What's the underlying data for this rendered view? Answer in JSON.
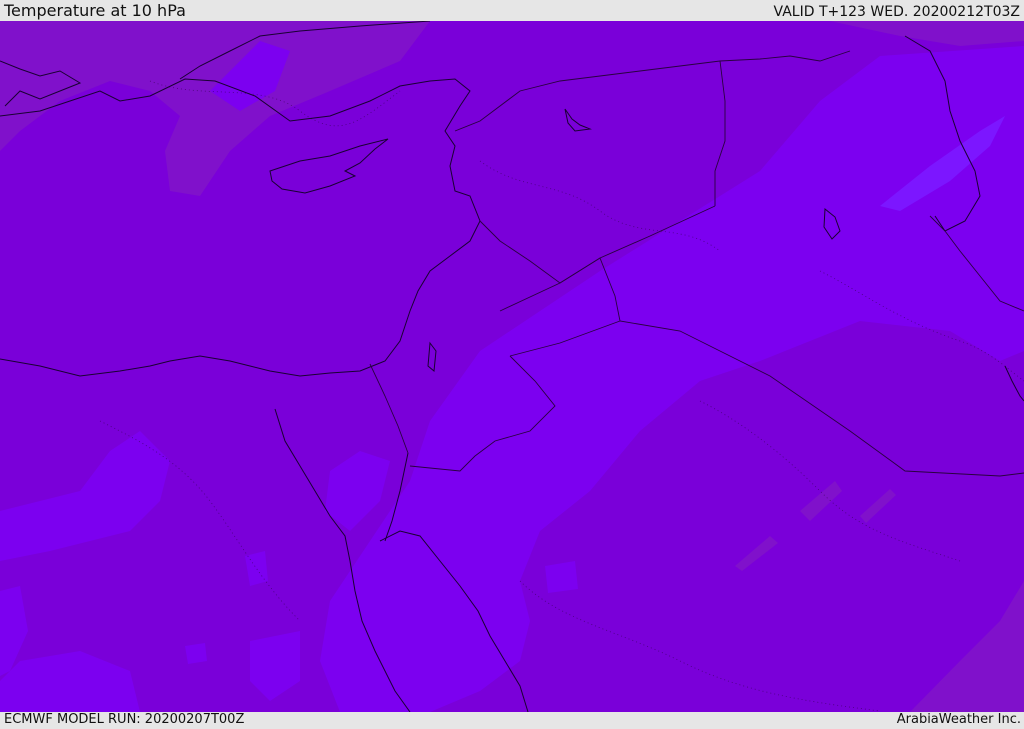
{
  "header": {
    "title": "Temperature at 10 hPa",
    "valid": "VALID T+123 WED. 20200212T03Z"
  },
  "footer": {
    "model_run": "ECMWF MODEL RUN: 20200207T00Z",
    "brand": "ArabiaWeather Inc."
  },
  "map": {
    "colors": {
      "base": "#7a00d9",
      "warm": "#8011cb",
      "cool": "#7c00f0",
      "coolest": "#7c16ff",
      "coastline": "#1a0033",
      "border": "#2a0040"
    }
  }
}
